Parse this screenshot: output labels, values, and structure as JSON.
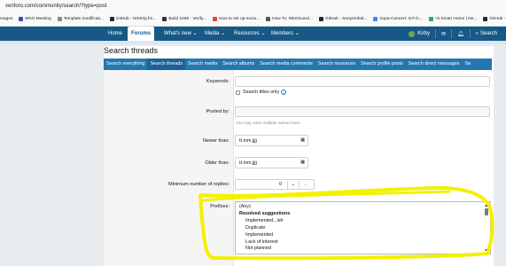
{
  "browser": {
    "url": "xenforo.com/community/search/?type=post",
    "bookmarks": [
      {
        "label": "mages",
        "color": "#ffffff"
      },
      {
        "label": "MSO Meeting",
        "color": "#2b5797"
      },
      {
        "label": "Template modificati...",
        "color": "#888888"
      },
      {
        "label": "GitHub - NiXIII/g.fm...",
        "color": "#24292e"
      },
      {
        "label": "Build 2468 - Verify...",
        "color": "#333333"
      },
      {
        "label": "How to set up-socia...",
        "color": "#ea4335"
      },
      {
        "label": "How To: WireGuard...",
        "color": "#555555"
      },
      {
        "label": "GitHub - Senyerobid...",
        "color": "#24292e"
      },
      {
        "label": "Supa-Convert: IoT-G...",
        "color": "#4285f4"
      },
      {
        "label": "+5 Smart Home | Ne...",
        "color": "#34a853"
      },
      {
        "label": "GitHub - spanHead...",
        "color": "#24292e"
      }
    ]
  },
  "nav": {
    "items": [
      "Home",
      "Forums",
      "What's new",
      "Media",
      "Resources",
      "Members"
    ],
    "active": "Forums",
    "user": "Kirby",
    "search_label": "Search"
  },
  "page": {
    "title": "Search threads",
    "tabs": [
      "Search everything",
      "Search threads",
      "Search media",
      "Search albums",
      "Search media comments",
      "Search resources",
      "Search profile posts",
      "Search direct messages",
      "Se"
    ],
    "active_tab": "Search threads"
  },
  "form": {
    "keywords_label": "Keywords:",
    "keywords_value": "",
    "titles_only_label": "Search titles only",
    "posted_by_label": "Posted by:",
    "posted_by_value": "",
    "posted_by_hint": "You may enter multiple names here.",
    "newer_than_label": "Newer than:",
    "newer_than_value": "tt.mm.jjjj",
    "older_than_label": "Older than:",
    "older_than_value": "tt.mm.jjjj",
    "min_replies_label": "Minimum number of replies:",
    "min_replies_value": "0",
    "stepper_plus": "+",
    "stepper_minus": "−",
    "prefixes_label": "Prefixes:",
    "prefix_options": [
      {
        "label": "(Any)",
        "kind": "option"
      },
      {
        "label": "Resolved suggestions",
        "kind": "group"
      },
      {
        "label": "Implemented...ish",
        "kind": "child"
      },
      {
        "label": "Duplicate",
        "kind": "child"
      },
      {
        "label": "Implemented",
        "kind": "child"
      },
      {
        "label": "Lack of interest",
        "kind": "child"
      },
      {
        "label": "Not planned",
        "kind": "child"
      }
    ]
  },
  "colors": {
    "nav_bg": "#185886",
    "tab_bg": "#2577b1",
    "highlight": "#f4f000"
  }
}
